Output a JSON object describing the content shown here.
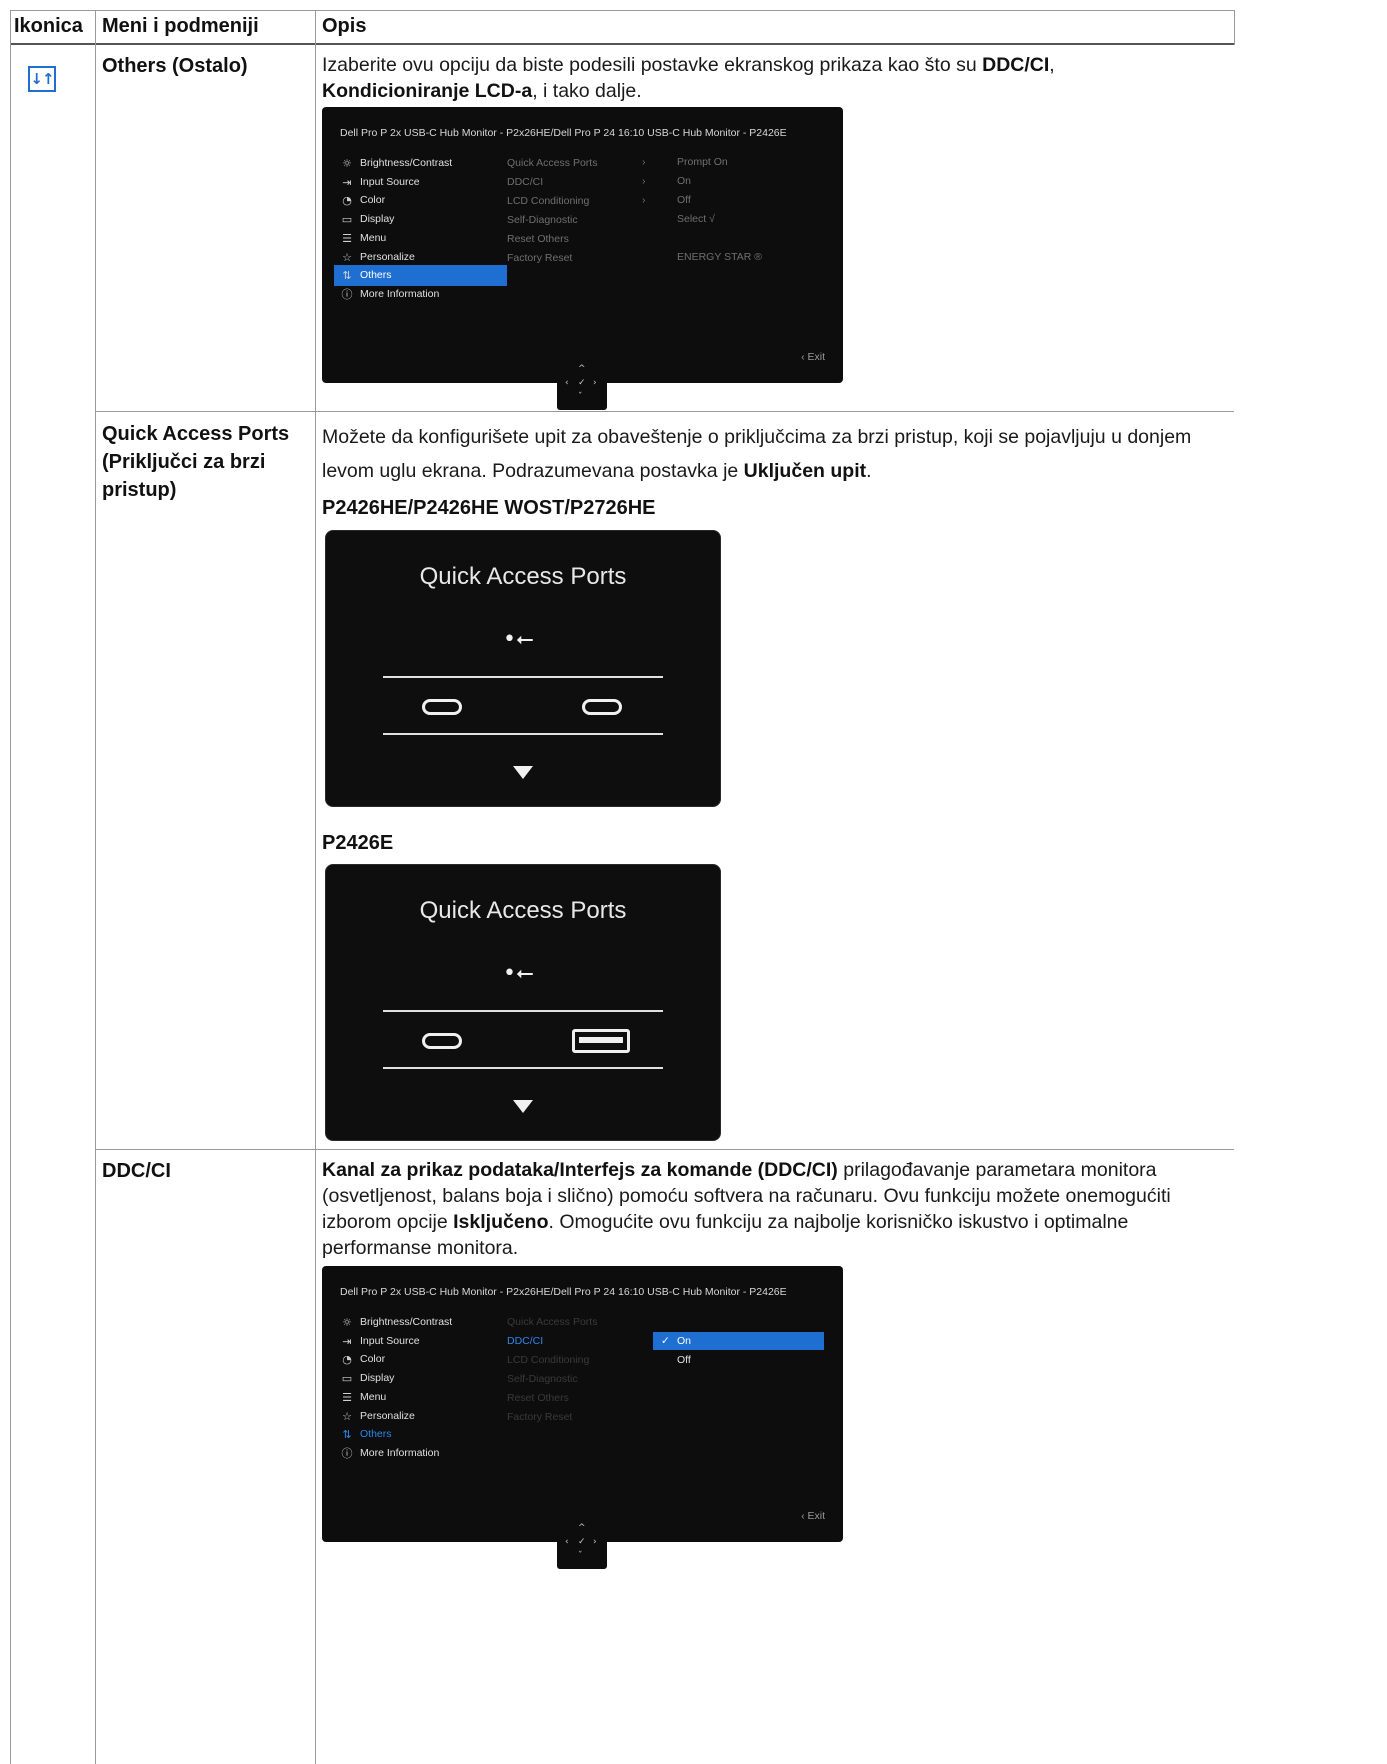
{
  "table": {
    "headers": [
      "Ikonica",
      "Meni i podmeniji",
      "Opis"
    ]
  },
  "icons": {
    "others": "others-icon"
  },
  "rows": [
    {
      "menu": "Others (Ostalo)",
      "desc": [
        {
          "t": "Izaberite ovu opciju da biste podesili postavke ekranskog prikaza kao što su "
        },
        {
          "t": "DDC/CI",
          "b": true
        },
        {
          "t": ", "
        },
        {
          "t": "Kondicioniranje LCD-a",
          "b": true
        },
        {
          "t": ", i tako dalje."
        }
      ]
    },
    {
      "menu": "Quick Access Ports (Priključci za brzi pristup)",
      "desc": [
        {
          "t": "Možete da konfigurišete upit za obaveštenje o priključcima za brzi pristup, koji se pojavljuju u donjem levom uglu ekrana. Podrazumevana postavka je "
        },
        {
          "t": "Uključen upit",
          "b": true
        },
        {
          "t": "."
        }
      ],
      "models": [
        "P2426HE/P2426HE WOST/P2726HE",
        "P2426E"
      ]
    },
    {
      "menu": "DDC/CI",
      "desc": [
        {
          "t": "Kanal za prikaz podataka/Interfejs za komande (DDC/CI)",
          "b": true
        },
        {
          "t": " prilagođavanje parametara monitora (osvetljenost, balans boja i slično) pomoću softvera na računaru. Ovu funkciju možete onemogućiti izborom opcije "
        },
        {
          "t": "Isključeno",
          "b": true
        },
        {
          "t": ". Omogućite ovu funkciju za najbolje korisničko iskustvo i optimalne performanse monitora."
        }
      ]
    }
  ],
  "osd": {
    "title": "Dell Pro P 2x USB-C Hub Monitor - P2x26HE/Dell Pro P 24 16:10 USB-C Hub Monitor - P2426E",
    "menu_items": [
      {
        "label": "Brightness/Contrast",
        "icon": "brightness-icon"
      },
      {
        "label": "Input Source",
        "icon": "input-source-icon"
      },
      {
        "label": "Color",
        "icon": "color-palette-icon"
      },
      {
        "label": "Display",
        "icon": "display-icon"
      },
      {
        "label": "Menu",
        "icon": "menu-icon"
      },
      {
        "label": "Personalize",
        "icon": "star-icon"
      },
      {
        "label": "Others",
        "icon": "others-icon"
      },
      {
        "label": "More Information",
        "icon": "info-icon"
      }
    ],
    "sub_items": [
      "Quick Access Ports",
      "DDC/CI",
      "LCD Conditioning",
      "Self-Diagnostic",
      "Reset Others",
      "Factory Reset"
    ],
    "values": [
      "Prompt On",
      "On",
      "Off",
      "Select √",
      "",
      "ENERGY STAR ®"
    ],
    "arrow": "›",
    "exit": "‹  Exit",
    "ddc_options": [
      {
        "label": "On",
        "selected": true,
        "check": "✓"
      },
      {
        "label": "Off",
        "selected": false
      }
    ]
  },
  "qap": {
    "title": "Quick Access Ports",
    "usb_symbol": "⭠"
  }
}
